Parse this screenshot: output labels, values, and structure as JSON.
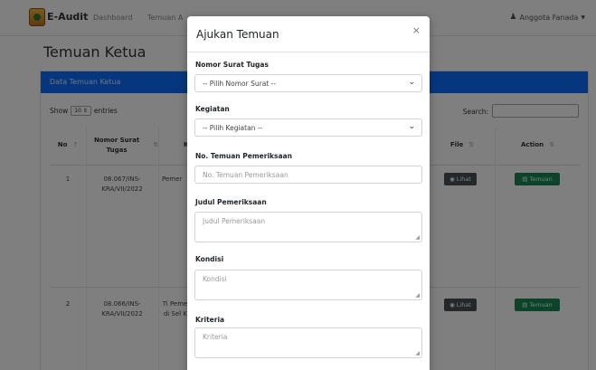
{
  "navbar": {
    "brand": "E-Audit",
    "links": [
      "Dashboard",
      "Temuan A"
    ],
    "user": "Anggota Fanada"
  },
  "page": {
    "title": "Temuan Ketua"
  },
  "card": {
    "header": "Data Temuan Ketua",
    "show_prefix": "Show",
    "show_value": "10",
    "show_suffix": "entries",
    "search_label": "Search:"
  },
  "table": {
    "headers": {
      "no": "No",
      "nomor_surat": "Nomor Surat Tugas",
      "k": "K",
      "file": "File",
      "action": "Action"
    },
    "rows": [
      {
        "no": "1",
        "nomor_surat": "08.067/INS-KRA/VII/2022",
        "kegiatan": "Pemer",
        "file_btn": "Lihat",
        "action_btn": "Temuan"
      },
      {
        "no": "2",
        "nomor_surat": "08.066/INS-KRA/VII/2022",
        "kegiatan": "Ti Pemer di Sel K.",
        "file_btn": "Lihat",
        "action_btn": "Temuan"
      }
    ]
  },
  "modal": {
    "title": "Ajukan Temuan",
    "close": "×",
    "fields": {
      "nomor_surat_tugas": {
        "label": "Nomor Surat Tugas",
        "value": "-- Pilih Nomor Surat --"
      },
      "kegiatan": {
        "label": "Kegiatan",
        "value": "-- Pilih Kegiatan --"
      },
      "no_temuan": {
        "label": "No. Temuan Pemeriksaan",
        "placeholder": "No. Temuan Pemeriksaan"
      },
      "judul": {
        "label": "Judul Pemeriksaan",
        "placeholder": "Judul Pemeriksaan"
      },
      "kondisi": {
        "label": "Kondisi",
        "placeholder": "Kondisi"
      },
      "kriteria": {
        "label": "Kriteria",
        "placeholder": "Kriteria"
      }
    }
  },
  "icons": {
    "user": "user-icon",
    "eye": "eye-icon",
    "file": "file-icon",
    "chevron": "chevron-down-icon",
    "close": "close-icon"
  },
  "colors": {
    "primary": "#0d6efd",
    "success": "#198754",
    "dark": "#495057"
  }
}
